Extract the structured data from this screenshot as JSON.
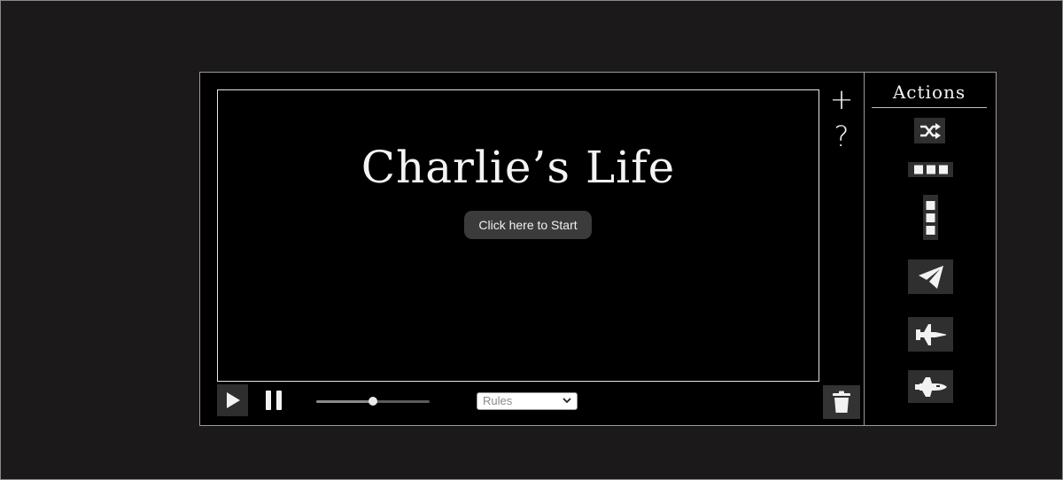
{
  "game": {
    "title": "Charlie’s Life",
    "start_label": "Click here to Start"
  },
  "side": {
    "plus_symbol": "+",
    "help_symbol": "?"
  },
  "controls": {
    "volume_fraction": 0.5,
    "rules_value": "Rules"
  },
  "actions": {
    "title": "Actions",
    "items": [
      {
        "icon": "shuffle-icon"
      },
      {
        "icon": "horizontal-dots-icon"
      },
      {
        "icon": "vertical-dots-icon"
      },
      {
        "icon": "paper-plane-icon"
      },
      {
        "icon": "fighter-jet-icon"
      },
      {
        "icon": "space-shuttle-icon"
      }
    ]
  },
  "colors": {
    "background": "#1b191a",
    "panel": "#000000",
    "button": "#2f2f2f",
    "text": "#f4f4f4"
  }
}
